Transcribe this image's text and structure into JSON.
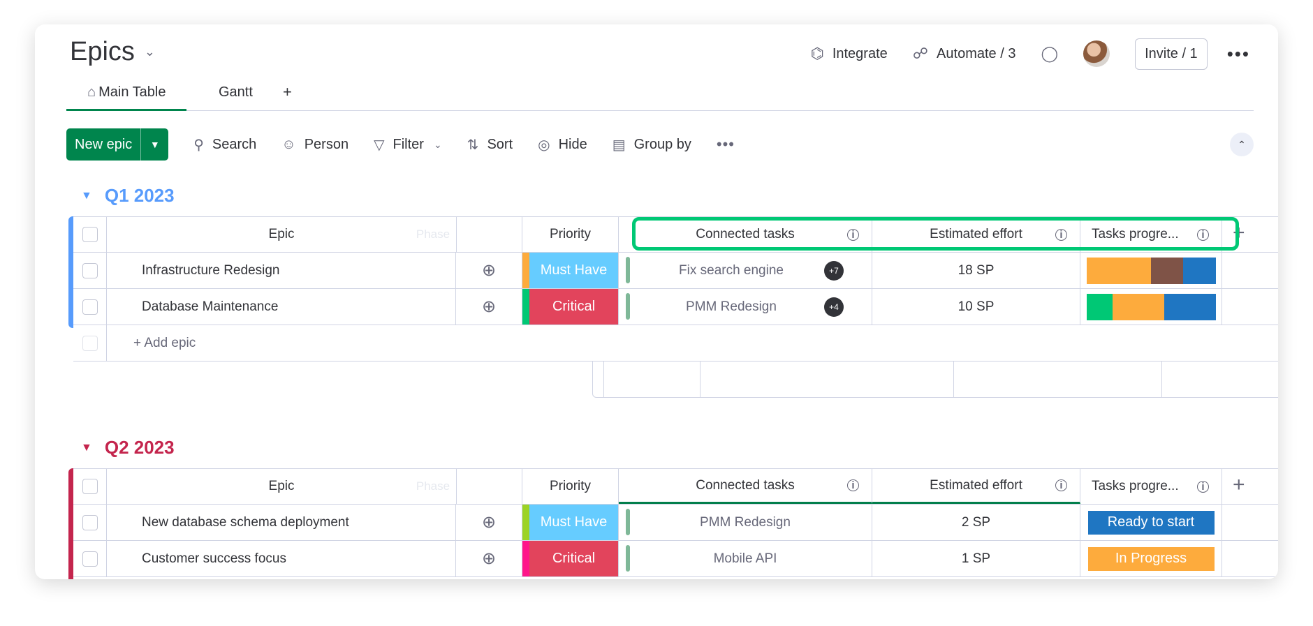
{
  "board": {
    "title": "Epics"
  },
  "topbar": {
    "integrate": "Integrate",
    "automate": "Automate / 3",
    "invite": "Invite / 1"
  },
  "tabs": [
    {
      "label": "Main Table"
    },
    {
      "label": "Gantt"
    },
    {
      "label": "+"
    }
  ],
  "toolbar": {
    "new_label": "New epic",
    "search": "Search",
    "person": "Person",
    "filter": "Filter",
    "sort": "Sort",
    "hide": "Hide",
    "group_by": "Group by"
  },
  "columns": {
    "epic": "Epic",
    "phase": "Phase",
    "priority": "Priority",
    "connected": "Connected tasks",
    "effort": "Estimated effort",
    "progress": "Tasks progre..."
  },
  "groups": [
    {
      "name": "Q1 2023",
      "color": "#579bfc",
      "rows": [
        {
          "epic": "Infrastructure Redesign",
          "phase_color": "#fdab3d",
          "priority": "Must Have",
          "priority_color": "#66ccff",
          "connected": "Fix search engine",
          "extra": "+7",
          "effort": "18 SP",
          "progress": [
            {
              "color": "#fdab3d",
              "value": 0.5
            },
            {
              "color": "#7f5347",
              "value": 0.25
            },
            {
              "color": "#1f76c2",
              "value": 0.25
            }
          ]
        },
        {
          "epic": "Database Maintenance",
          "phase_color": "#00c875",
          "priority": "Critical",
          "priority_color": "#e2445c",
          "connected": "PMM Redesign",
          "extra": "+4",
          "effort": "10 SP",
          "progress": [
            {
              "color": "#00c875",
              "value": 0.2
            },
            {
              "color": "#fdab3d",
              "value": 0.4
            },
            {
              "color": "#1f76c2",
              "value": 0.4
            }
          ]
        }
      ],
      "add_label": "+ Add epic"
    },
    {
      "name": "Q2 2023",
      "color": "#c4254d",
      "rows": [
        {
          "epic": "New database schema deployment",
          "phase_color": "#9cd326",
          "priority": "Must Have",
          "priority_color": "#66ccff",
          "connected": "PMM Redesign",
          "effort": "2 SP",
          "progress_label": "Ready to start",
          "progress_color": "#1f76c2"
        },
        {
          "epic": "Customer success focus",
          "phase_color": "#ff158a",
          "priority": "Critical",
          "priority_color": "#e2445c",
          "connected": "Mobile API",
          "effort": "1 SP",
          "progress_label": "In Progress",
          "progress_color": "#fdab3d"
        }
      ]
    }
  ]
}
